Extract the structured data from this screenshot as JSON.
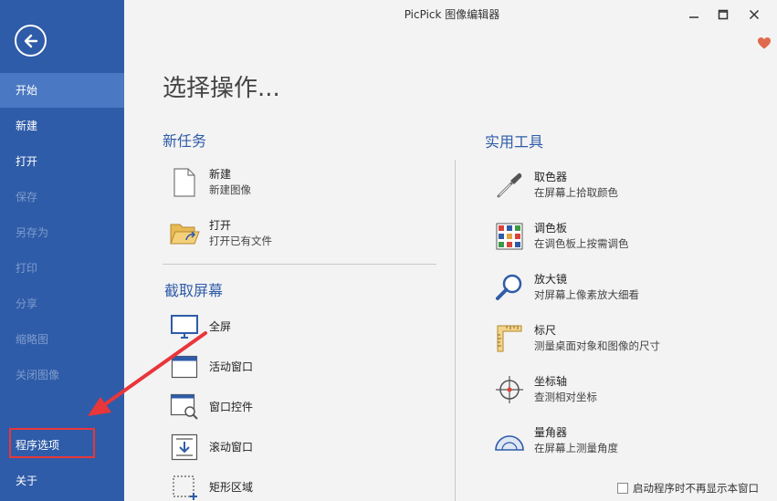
{
  "window": {
    "title": "PicPick 图像编辑器"
  },
  "sidebar": {
    "items": [
      {
        "label": "开始",
        "state": "active"
      },
      {
        "label": "新建",
        "state": "normal"
      },
      {
        "label": "打开",
        "state": "normal"
      },
      {
        "label": "保存",
        "state": "disabled"
      },
      {
        "label": "另存为",
        "state": "disabled"
      },
      {
        "label": "打印",
        "state": "disabled"
      },
      {
        "label": "分享",
        "state": "disabled"
      },
      {
        "label": "缩略图",
        "state": "disabled"
      },
      {
        "label": "关闭图像",
        "state": "disabled"
      },
      {
        "label": "程序选项",
        "state": "highlighted"
      },
      {
        "label": "关于",
        "state": "normal"
      }
    ]
  },
  "main": {
    "heading": "选择操作...",
    "new_task": {
      "title": "新任务",
      "items": [
        {
          "name": "新建",
          "desc": "新建图像",
          "icon": "document-icon"
        },
        {
          "name": "打开",
          "desc": "打开已有文件",
          "icon": "open-folder-icon"
        }
      ]
    },
    "capture": {
      "title": "截取屏幕",
      "items": [
        {
          "name": "全屏",
          "icon": "monitor-icon"
        },
        {
          "name": "活动窗口",
          "icon": "window-icon"
        },
        {
          "name": "窗口控件",
          "icon": "window-control-icon"
        },
        {
          "name": "滚动窗口",
          "icon": "scroll-window-icon"
        },
        {
          "name": "矩形区域",
          "icon": "rect-region-icon"
        }
      ]
    },
    "utilities": {
      "title": "实用工具",
      "items": [
        {
          "name": "取色器",
          "desc": "在屏幕上拾取颜色",
          "icon": "eyedropper-icon"
        },
        {
          "name": "调色板",
          "desc": "在调色板上按需调色",
          "icon": "palette-icon"
        },
        {
          "name": "放大镜",
          "desc": "对屏幕上像素放大细看",
          "icon": "magnifier-icon"
        },
        {
          "name": "标尺",
          "desc": "测量桌面对象和图像的尺寸",
          "icon": "ruler-icon"
        },
        {
          "name": "坐标轴",
          "desc": "查测相对坐标",
          "icon": "crosshair-icon"
        },
        {
          "name": "量角器",
          "desc": "在屏幕上测量角度",
          "icon": "protractor-icon"
        }
      ]
    },
    "startup_checkbox": {
      "label": "启动程序时不再显示本窗口",
      "checked": false
    }
  },
  "colors": {
    "sidebar": "#2f5ca8",
    "sidebar_active": "#4b78c2",
    "accent": "#2f5ca8",
    "highlight": "#e8363a"
  }
}
